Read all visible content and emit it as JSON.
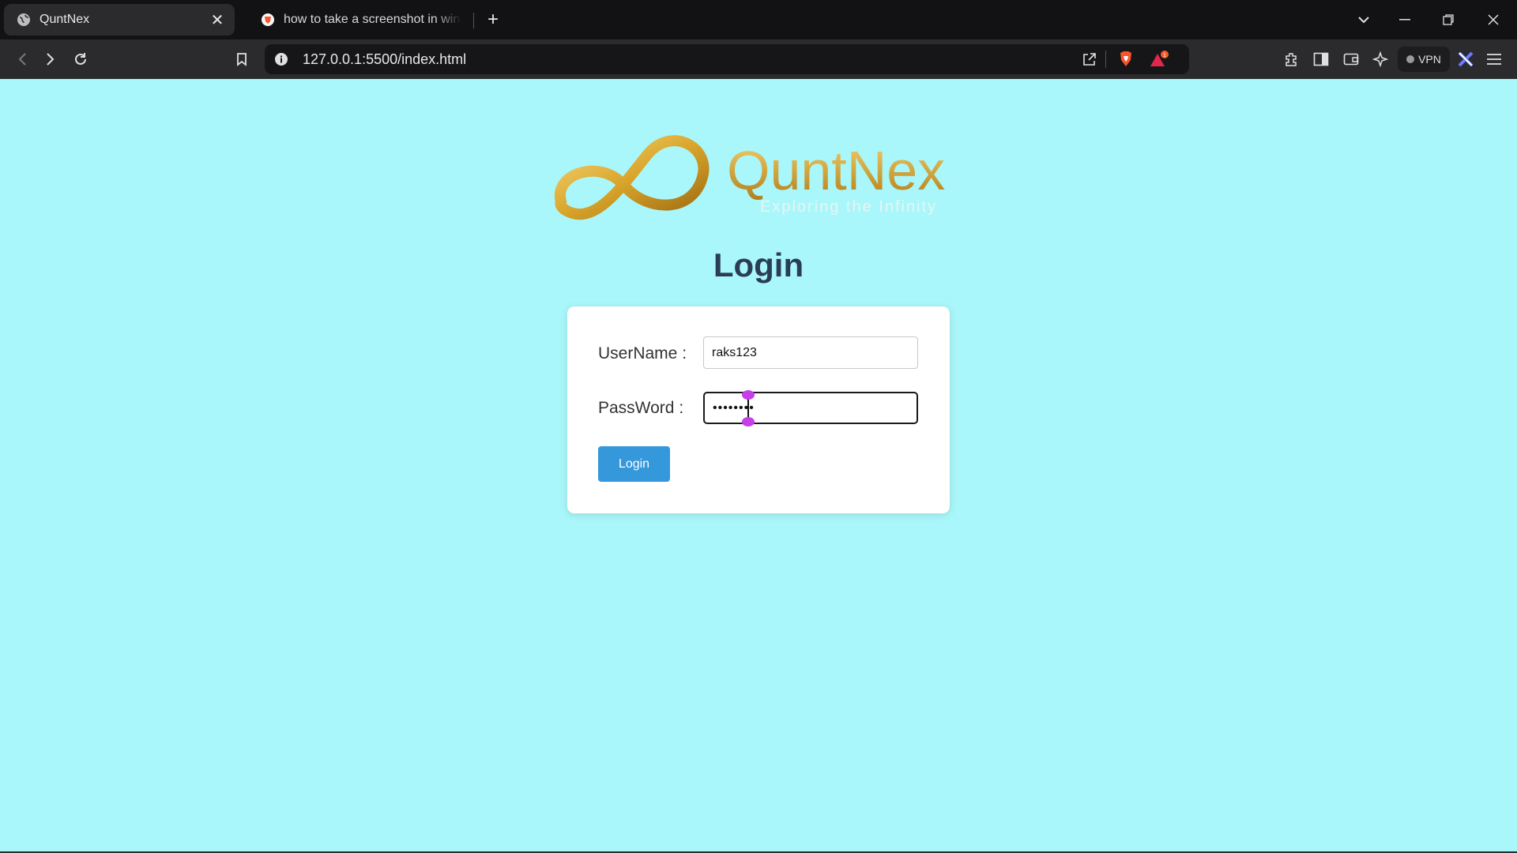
{
  "browser": {
    "tabs": [
      {
        "title": "QuntNex",
        "active": true
      },
      {
        "title": "how to take a screenshot in window",
        "active": false
      }
    ],
    "address": "127.0.0.1:5500/index.html",
    "vpn_label": "VPN",
    "notification_count": "1"
  },
  "logo": {
    "brand": "QuntNex",
    "tagline": "Exploring the Infinity"
  },
  "page": {
    "title": "Login",
    "username_label": "UserName :",
    "username_value": "raks123",
    "password_label": "PassWord :",
    "password_value": "••••••••",
    "login_button": "Login"
  },
  "colors": {
    "page_background": "#a9f7fa",
    "title": "#2a3d55",
    "button": "#3498db",
    "logo_gold": "#d9a52b",
    "selection_handle": "#c63ee8"
  },
  "icons": [
    "globe-icon",
    "brave-icon",
    "close-icon",
    "plus-icon",
    "chevron-down-icon",
    "minimize-icon",
    "restore-icon",
    "window-close-icon",
    "back-icon",
    "forward-icon",
    "reload-icon",
    "bookmark-icon",
    "info-icon",
    "share-icon",
    "brave-shields-icon",
    "brave-rewards-icon",
    "extensions-icon",
    "sidebar-icon",
    "wallet-icon",
    "leo-ai-icon",
    "vpn-icon",
    "profile-icon",
    "menu-icon"
  ]
}
